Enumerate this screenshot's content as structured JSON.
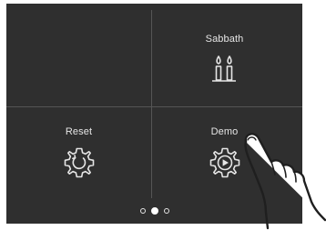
{
  "tiles": {
    "top_left": {
      "label": ""
    },
    "sabbath": {
      "label": "Sabbath",
      "icon": "candles-icon"
    },
    "reset": {
      "label": "Reset",
      "icon": "gear-reset-icon"
    },
    "demo": {
      "label": "Demo",
      "icon": "gear-play-icon"
    }
  },
  "pager": {
    "count": 3,
    "active_index": 1
  },
  "colors": {
    "screen_bg": "#2f2f2f",
    "text": "#e6e6e6",
    "divider": "#555555"
  }
}
